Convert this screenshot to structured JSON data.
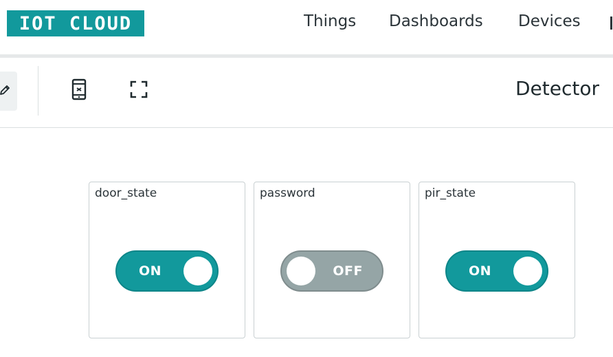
{
  "header": {
    "logo": "IOT CLOUD",
    "nav": [
      "Things",
      "Dashboards",
      "Devices"
    ]
  },
  "toolbar": {
    "icons": [
      "edit-icon",
      "mobile-view-icon",
      "fullscreen-icon"
    ],
    "dashboard_title": "Detector"
  },
  "widgets": [
    {
      "label": "door_state",
      "state_text": "ON",
      "on": true
    },
    {
      "label": "password",
      "state_text": "OFF",
      "on": false
    },
    {
      "label": "pir_state",
      "state_text": "ON",
      "on": true
    }
  ],
  "colors": {
    "accent": "#12999c",
    "switch_off": "#95a5a6",
    "divider": "#e6e8e9"
  }
}
